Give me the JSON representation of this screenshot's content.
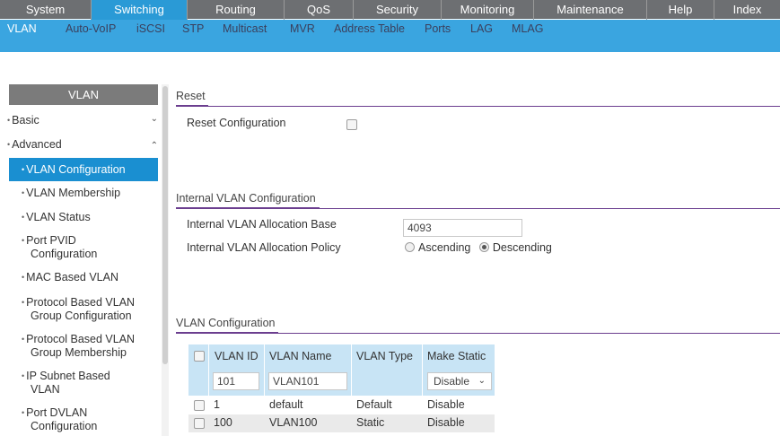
{
  "topnav": {
    "tabs": [
      {
        "label": "System"
      },
      {
        "label": "Switching"
      },
      {
        "label": "Routing"
      },
      {
        "label": "QoS"
      },
      {
        "label": "Security"
      },
      {
        "label": "Monitoring"
      },
      {
        "label": "Maintenance"
      },
      {
        "label": "Help"
      },
      {
        "label": "Index"
      }
    ],
    "active_color": "#2a9ad6",
    "bg_color": "#6d6f72"
  },
  "subnav": {
    "items": [
      {
        "label": "VLAN"
      },
      {
        "label": "Auto-VoIP"
      },
      {
        "label": "iSCSI"
      },
      {
        "label": "STP"
      },
      {
        "label": "Multicast"
      },
      {
        "label": "MVR"
      },
      {
        "label": "Address Table"
      },
      {
        "label": "Ports"
      },
      {
        "label": "LAG"
      },
      {
        "label": "MLAG"
      }
    ]
  },
  "sidebar": {
    "header": "VLAN",
    "basic": "Basic",
    "advanced": "Advanced",
    "items": [
      {
        "label": "VLAN Configuration"
      },
      {
        "label": "VLAN Membership"
      },
      {
        "label": "VLAN Status"
      },
      {
        "label": "Port PVID",
        "label2": "Configuration"
      },
      {
        "label": "MAC Based VLAN"
      },
      {
        "label": "Protocol Based VLAN",
        "label2": "Group Configuration"
      },
      {
        "label": "Protocol Based VLAN",
        "label2": "Group Membership"
      },
      {
        "label": "IP Subnet Based",
        "label2": "VLAN"
      },
      {
        "label": "Port DVLAN",
        "label2": "Configuration"
      }
    ]
  },
  "reset": {
    "title": "Reset",
    "label": "Reset Configuration"
  },
  "internal": {
    "title": "Internal VLAN Configuration",
    "base_label": "Internal VLAN Allocation Base",
    "base_value": "4093",
    "policy_label": "Internal VLAN Allocation Policy",
    "ascending": "Ascending",
    "descending": "Descending"
  },
  "vlan_config": {
    "title": "VLAN Configuration",
    "columns": [
      "VLAN ID",
      "VLAN Name",
      "VLAN Type",
      "Make Static"
    ],
    "input_row": {
      "vlan_id": "101",
      "vlan_name": "VLAN101",
      "make_static": "Disable"
    },
    "rows": [
      {
        "vlan_id": "1",
        "vlan_name": "default",
        "vlan_type": "Default",
        "make_static": "Disable"
      },
      {
        "vlan_id": "100",
        "vlan_name": "VLAN100",
        "vlan_type": "Static",
        "make_static": "Disable"
      }
    ]
  },
  "colors": {
    "accent_purple": "#6b3e8f",
    "subnav_blue": "#3aa5e0",
    "sidebar_active": "#1a8fd1",
    "table_header": "#c8e4f5"
  }
}
